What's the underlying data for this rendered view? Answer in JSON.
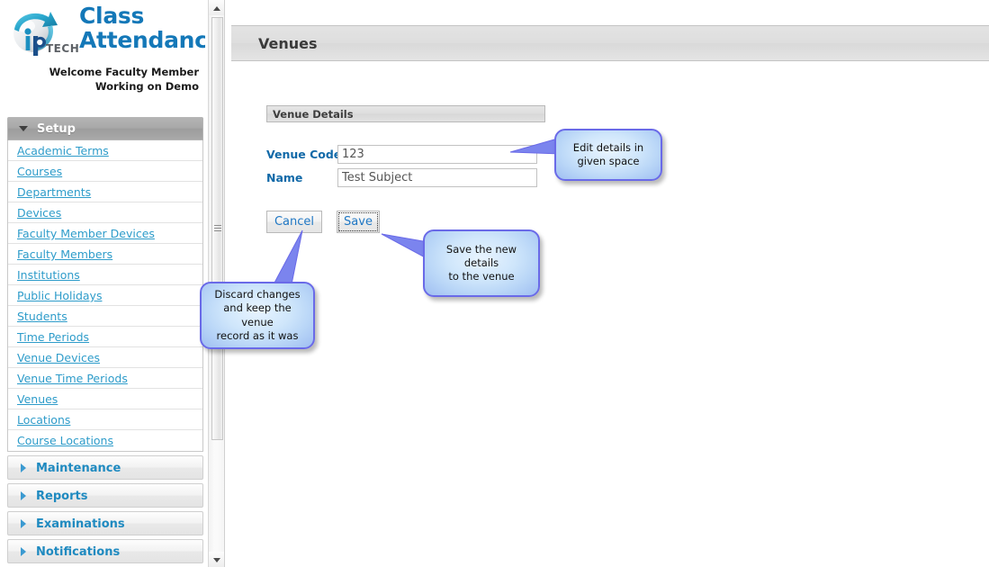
{
  "brand": {
    "logo_icon": "iptech-globe-arrow-logo",
    "title_line1": "Class",
    "title_line2": "Attendance",
    "logo_text": "TECH",
    "welcome_line1": "Welcome Faculty Member",
    "welcome_line2": "Working on Demo",
    "accent_color": "#1478b8"
  },
  "sidebar": {
    "sections": [
      {
        "label": "Setup",
        "expanded": true,
        "icon": "chevron-down-icon",
        "items": [
          {
            "label": "Academic Terms"
          },
          {
            "label": "Courses"
          },
          {
            "label": "Departments"
          },
          {
            "label": "Devices"
          },
          {
            "label": "Faculty Member Devices"
          },
          {
            "label": "Faculty Members"
          },
          {
            "label": "Institutions"
          },
          {
            "label": "Public Holidays"
          },
          {
            "label": "Students"
          },
          {
            "label": "Time Periods"
          },
          {
            "label": "Venue Devices"
          },
          {
            "label": "Venue Time Periods"
          },
          {
            "label": "Venues"
          },
          {
            "label": "Locations"
          },
          {
            "label": "Course Locations"
          }
        ]
      },
      {
        "label": "Maintenance",
        "expanded": false,
        "icon": "chevron-right-icon",
        "items": []
      },
      {
        "label": "Reports",
        "expanded": false,
        "icon": "chevron-right-icon",
        "items": []
      },
      {
        "label": "Examinations",
        "expanded": false,
        "icon": "chevron-right-icon",
        "items": []
      },
      {
        "label": "Notifications",
        "expanded": false,
        "icon": "chevron-right-icon",
        "items": []
      }
    ],
    "link_color": "#2e9cca"
  },
  "scrollbar": {
    "up_icon": "caret-up-icon",
    "down_icon": "caret-down-icon",
    "grip_icon": "scroll-grip-icon"
  },
  "header": {
    "page_title": "Venues"
  },
  "form": {
    "section_title": "Venue Details",
    "fields": [
      {
        "label": "Venue Code",
        "value": "123",
        "placeholder": ""
      },
      {
        "label": "Name",
        "value": "Test Subject",
        "placeholder": ""
      }
    ],
    "buttons": {
      "cancel_label": "Cancel",
      "save_label": "Save"
    }
  },
  "callouts": [
    {
      "id": "edit",
      "text": "Edit details in\ngiven space"
    },
    {
      "id": "save",
      "text": "Save the new details\nto the venue"
    },
    {
      "id": "cancel",
      "text": "Discard changes\nand keep the venue\nrecord as it was"
    }
  ],
  "colors": {
    "callout_border": "#6a6ae8",
    "callout_fill": "#cfe6fb",
    "label_blue": "#1169a8",
    "button_text": "#1f77c4"
  }
}
